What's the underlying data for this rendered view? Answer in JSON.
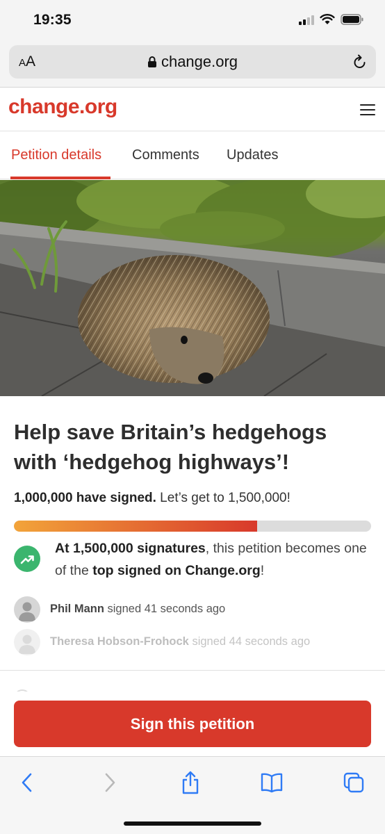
{
  "status": {
    "time": "19:35"
  },
  "browser": {
    "aa_label": "AA",
    "url": "change.org"
  },
  "site": {
    "logo": "change.org",
    "menu_icon": "hamburger-menu-icon"
  },
  "tabs": [
    {
      "label": "Petition details",
      "active": true
    },
    {
      "label": "Comments",
      "active": false
    },
    {
      "label": "Updates",
      "active": false
    }
  ],
  "hero": {
    "image": "hedgehog-photo"
  },
  "petition": {
    "title": "Help save Britain’s hedgehogs with ‘hedgehog highways’!",
    "signed_count": "1,000,000 have signed.",
    "goal_text": " Let’s get to 1,500,000!",
    "progress_fraction": 0.68,
    "milestone_bold_1": "At 1,500,000 signatures",
    "milestone_text_1": ", this petition becomes one of the ",
    "milestone_bold_2": "top signed on Change.org",
    "milestone_text_2": "!"
  },
  "recent_signers": [
    {
      "name": "Phil Mann",
      "action": " signed 41 seconds ago"
    },
    {
      "name": "Theresa Hobson-Frohock",
      "action": " signed 44 seconds ago"
    }
  ],
  "cta": {
    "sign_label": "Sign this petition"
  },
  "colors": {
    "brand": "#d8392b",
    "progress_start": "#f2a43a",
    "milestone_icon": "#3bb56e"
  }
}
